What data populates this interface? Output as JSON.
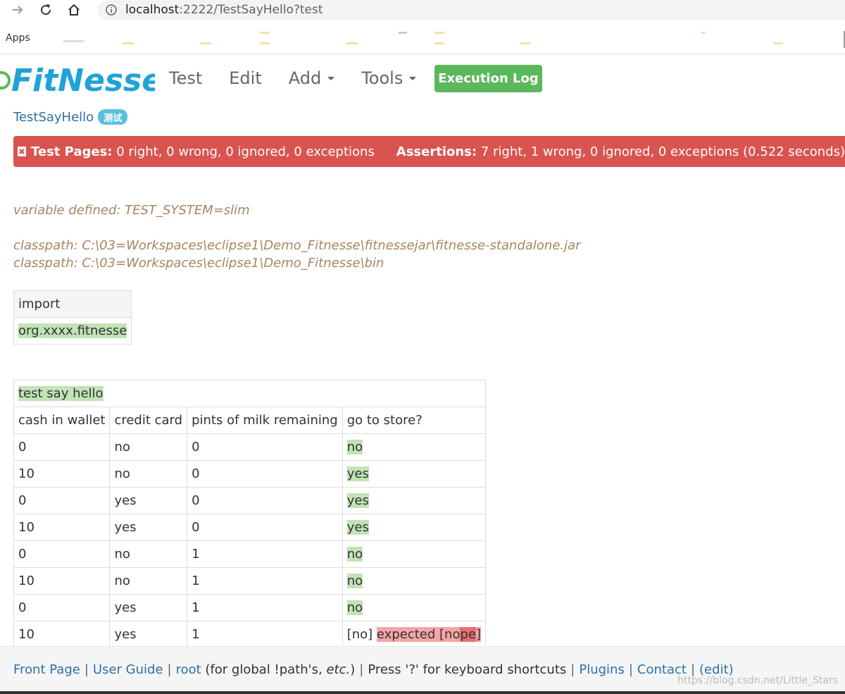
{
  "browser": {
    "url_host": "localhost",
    "url_path": ":2222/TestSayHello?test",
    "bookmarks_apps": "Apps"
  },
  "header": {
    "logo_text": "FitNesse",
    "nav": [
      {
        "label": "Test"
      },
      {
        "label": "Edit"
      },
      {
        "label": "Add"
      },
      {
        "label": "Tools"
      }
    ],
    "execution_log": "Execution Log"
  },
  "breadcrumb": {
    "page": "TestSayHello",
    "badge": "测试"
  },
  "summary": {
    "test_pages_label": "Test Pages:",
    "test_pages_value": "0 right, 0 wrong, 0 ignored, 0 exceptions",
    "assertions_label": "Assertions:",
    "assertions_value": "7 right, 1 wrong, 0 ignored, 0 exceptions (0.522 seconds)"
  },
  "comments": {
    "variable": "variable defined: TEST_SYSTEM=slim",
    "classpath1": "classpath: C:\\03=Workspaces\\eclipse1\\Demo_Fitnesse\\fitnessejar\\fitnesse-standalone.jar",
    "classpath2": "classpath: C:\\03=Workspaces\\eclipse1\\Demo_Fitnesse\\bin"
  },
  "import_table": {
    "header": "import",
    "value": "org.xxxx.fitnesse"
  },
  "decision_table": {
    "title": "test say hello",
    "columns": [
      "cash in wallet",
      "credit card",
      "pints of milk remaining",
      "go to store?"
    ],
    "rows": [
      [
        "0",
        "no",
        "0",
        "no"
      ],
      [
        "10",
        "no",
        "0",
        "yes"
      ],
      [
        "0",
        "yes",
        "0",
        "yes"
      ],
      [
        "10",
        "yes",
        "0",
        "yes"
      ],
      [
        "0",
        "no",
        "1",
        "no"
      ],
      [
        "10",
        "no",
        "1",
        "no"
      ],
      [
        "0",
        "yes",
        "1",
        "no"
      ],
      [
        "10",
        "yes",
        "1",
        "[no]"
      ]
    ],
    "last_fail": {
      "prefix": "expected [no",
      "highlight": "pe",
      "suffix": "]"
    }
  },
  "footer": {
    "front_page": "Front Page",
    "user_guide": "User Guide",
    "root": "root",
    "root_note_a": "(for global !path's, ",
    "root_note_etc": "etc.",
    "root_note_b": ")",
    "shortcuts": "Press '?' for keyboard shortcuts",
    "plugins": "Plugins",
    "contact": "Contact",
    "edit": "(edit)",
    "watermark": "https://blog.csdn.net/Little_Stars"
  }
}
